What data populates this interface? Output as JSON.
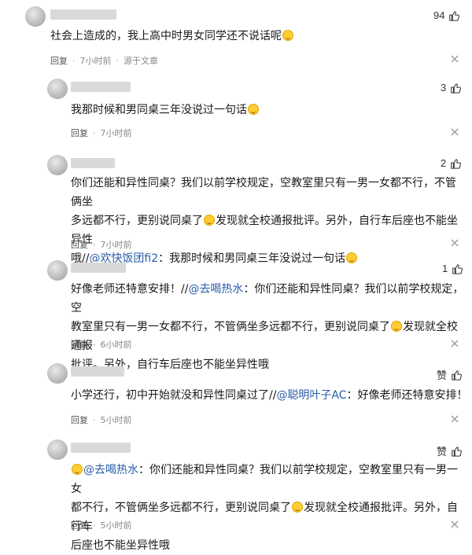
{
  "comments": [
    {
      "likes": "94",
      "text": "社会上造成的，我上高中时男女同学还不说话呢",
      "reply_label": "回复",
      "time": "7小时前",
      "source": "源于文章"
    },
    {
      "likes": "3",
      "text": "我那时候和男同桌三年没说过一句话",
      "reply_label": "回复",
      "time": "7小时前"
    },
    {
      "likes": "2",
      "text_line1": "你们还能和异性同桌？我们以前学校规定，空教室里只有一男一女都不行，不管俩坐",
      "text_line2a": "多远都不行，更别说同桌了",
      "text_line2b": "发现就全校通报批评。另外，自行车后座也不能坐异性",
      "text_line3a": "哦//",
      "mention": "@欢快饭团fi2",
      "text_line3b": "：我那时候和男同桌三年没说过一句话",
      "reply_label": "回复",
      "time": "7小时前"
    },
    {
      "likes": "1",
      "text_line1a": "好像老师还特意安排！//",
      "mention": "@去喝热水",
      "text_line1b": "：你们还能和异性同桌？我们以前学校规定，空",
      "text_line2a": "教室里只有一男一女都不行，不管俩坐多远都不行，更别说同桌了",
      "text_line2b": "发现就全校通报",
      "text_line3": "批评。另外，自行车后座也不能坐异性哦",
      "reply_label": "回复",
      "time": "6小时前"
    },
    {
      "likes": "赞",
      "text_a": "小学还行，初中开始就没和异性同桌过了//",
      "mention": "@聪明叶子AC",
      "text_b": "：好像老师还特意安排！",
      "reply_label": "回复",
      "time": "5小时前"
    },
    {
      "likes": "赞",
      "mention": "@去喝热水",
      "text_line1": "：你们还能和异性同桌？我们以前学校规定，空教室里只有一男一女",
      "text_line2a": "都不行，不管俩坐多远都不行，更别说同桌了",
      "text_line2b": "发现就全校通报批评。另外，自行车",
      "text_line3": "后座也不能坐异性哦",
      "reply_label": "回复",
      "time": "5小时前"
    }
  ],
  "icons": {
    "like": "thumbs-up-icon",
    "close": "close-icon",
    "emoji": "laughing-emoji-icon"
  },
  "colors": {
    "mention": "#2a5da8",
    "meta": "#888888"
  }
}
